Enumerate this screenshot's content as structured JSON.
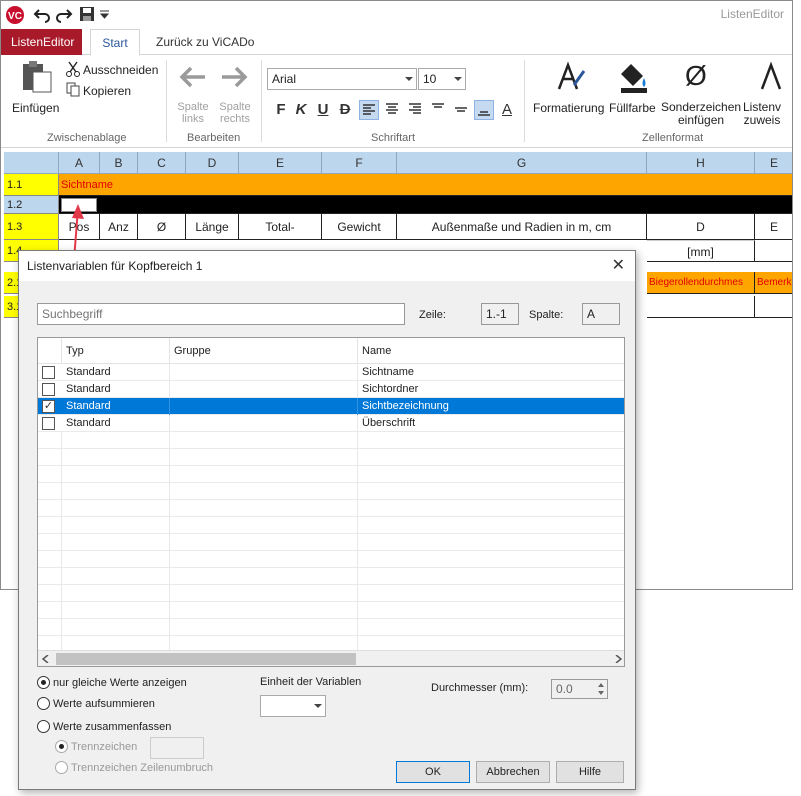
{
  "app": {
    "title": "ListenEditor"
  },
  "tabs": {
    "file": "ListenEditor",
    "start": "Start",
    "back": "Zurück zu ViCADo"
  },
  "ribbon": {
    "paste": "Einfügen",
    "cut": "Ausschneiden",
    "copy": "Kopieren",
    "group_clipboard": "Zwischenablage",
    "col_left_1": "Spalte",
    "col_left_2": "links",
    "col_right_1": "Spalte",
    "col_right_2": "rechts",
    "group_edit": "Bearbeiten",
    "font_name": "Arial",
    "font_size": "10",
    "bold": "F",
    "italic": "K",
    "underline": "U",
    "strike": "D",
    "fontcolor": "A",
    "group_font": "Schriftart",
    "formatting": "Formatierung",
    "fill": "Füllfarbe",
    "special_1": "Sonderzeichen",
    "special_2": "einfügen",
    "listvar_1": "Listenv",
    "listvar_2": "zuweis",
    "group_cellformat": "Zellenformat",
    "glyph_o": "Ø"
  },
  "sheet": {
    "columns": [
      "A",
      "B",
      "C",
      "D",
      "E",
      "F",
      "G",
      "H",
      "E"
    ],
    "rows": [
      "1.1",
      "1.2",
      "1.3",
      "1.4",
      "2.1",
      "3.1"
    ],
    "r1_a": "Sichtname",
    "r3": [
      "Pos",
      "Anz",
      "Ø",
      "Länge",
      "Total-",
      "Gewicht",
      "Außenmaße und Radien in m, cm",
      "D",
      "E"
    ],
    "r4_h": "[mm]",
    "r5_h": "Biegerollendurchmes",
    "r5_i": "Bemerk"
  },
  "dialog": {
    "title": "Listenvariablen für Kopfbereich 1",
    "close": "✕",
    "search_placeholder": "Suchbegriff",
    "row_label": "Zeile:",
    "row_value": "1.-1",
    "col_label": "Spalte:",
    "col_value": "A",
    "headers": {
      "type": "Typ",
      "group": "Gruppe",
      "name": "Name"
    },
    "items": [
      {
        "type": "Standard",
        "group": "",
        "name": "Sichtname",
        "checked": false
      },
      {
        "type": "Standard",
        "group": "",
        "name": "Sichtordner",
        "checked": false
      },
      {
        "type": "Standard",
        "group": "",
        "name": "Sichtbezeichnung",
        "checked": true
      },
      {
        "type": "Standard",
        "group": "",
        "name": "Überschrift",
        "checked": false
      }
    ],
    "opt_same": "nur gleiche Werte anzeigen",
    "opt_sum": "Werte aufsummieren",
    "opt_merge": "Werte zusammenfassen",
    "opt_sep": "Trennzeichen",
    "opt_sep_break": "Trennzeichen Zeilenumbruch",
    "unit_label": "Einheit der Variablen",
    "diameter_label": "Durchmesser (mm):",
    "diameter_value": "0.0",
    "ok": "OK",
    "cancel": "Abbrechen",
    "help": "Hilfe"
  },
  "colors": {
    "accent": "#a8192a",
    "selection": "#0078d7",
    "orange": "#ffa500",
    "yellow": "#ffff00",
    "header": "#bcd6ee"
  }
}
